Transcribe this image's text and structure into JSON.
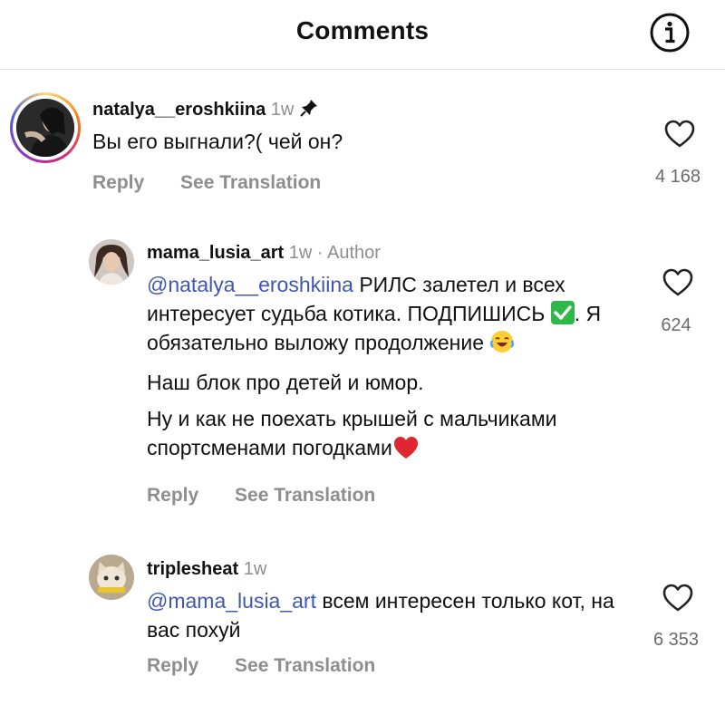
{
  "header": {
    "title": "Comments",
    "info_icon": "info-circle-icon"
  },
  "comments": [
    {
      "username": "natalya__eroshkiina",
      "time": "1w",
      "pinned": true,
      "text": "Вы его выгнали?( чей он?",
      "actions": {
        "reply": "Reply",
        "translate": "See Translation"
      },
      "likes": "4 168"
    },
    {
      "username": "mama_lusia_art",
      "time": "1w",
      "author_label": "· Author",
      "mention": "@natalya__eroshkiina",
      "text_line1": " РИЛС залетел и всех интересует судьба котика. ПОДПИШИСЬ ",
      "text_line1b": ". Я обязательно выложу продолжение ",
      "text_p2": "Наш блок про детей и юмор.",
      "text_p3": "Ну и как не поехать крышей с мальчиками спортсменами погодками",
      "actions": {
        "reply": "Reply",
        "translate": "See Translation"
      },
      "likes": "624"
    },
    {
      "username": "triplesheat",
      "time": "1w",
      "mention": "@mama_lusia_art",
      "text": " всем интересен только кот, на вас похуй",
      "actions": {
        "reply": "Reply",
        "translate": "See Translation"
      },
      "likes": "6 353"
    }
  ],
  "icons": {
    "like": "heart-outline-icon",
    "pin": "pin-icon"
  },
  "colors": {
    "mention": "#3f56b5",
    "muted": "#8e8e8e"
  }
}
